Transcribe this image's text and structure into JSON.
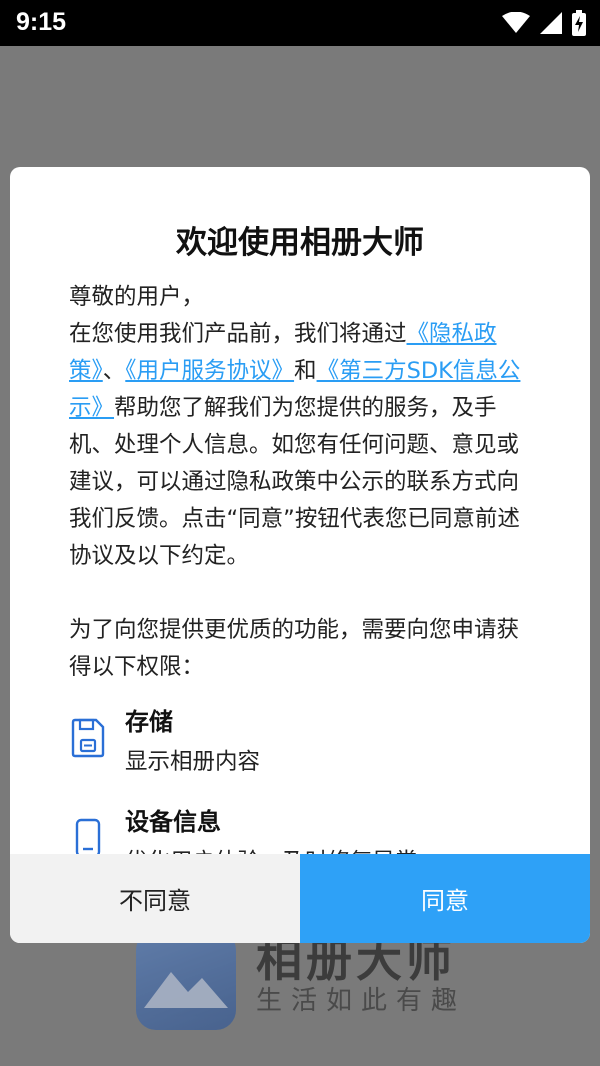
{
  "status_bar": {
    "time": "9:15"
  },
  "splash": {
    "app_name": "相册大师",
    "slogan": "生活如此有趣"
  },
  "dialog": {
    "title": "欢迎使用相册大师",
    "greeting": "尊敬的用户，",
    "intro_before": "在您使用我们产品前，我们将通过",
    "link_privacy": "《隐私政策》",
    "sep1": "、",
    "link_service": "《用户服务协议》",
    "sep2": "和",
    "link_sdk": "《第三方SDK信息公示》",
    "intro_after": "帮助您了解我们为您提供的服务，及手机、处理个人信息。如您有任何问题、意见或建议，可以通过隐私政策中公示的联系方式向我们反馈。点击“同意”按钮代表您已同意前述协议及以下约定。",
    "permissions_intro": "为了向您提供更优质的功能，需要向您申请获得以下权限：",
    "permissions": [
      {
        "name": "存储",
        "desc": "显示相册内容",
        "icon": "storage-icon"
      },
      {
        "name": "设备信息",
        "desc": "优化用户体验，及时修复异常",
        "icon": "phone-icon"
      }
    ],
    "buttons": {
      "disagree": "不同意",
      "agree": "同意"
    }
  },
  "colors": {
    "accent": "#2ea1f7",
    "link": "#2a9df4"
  }
}
